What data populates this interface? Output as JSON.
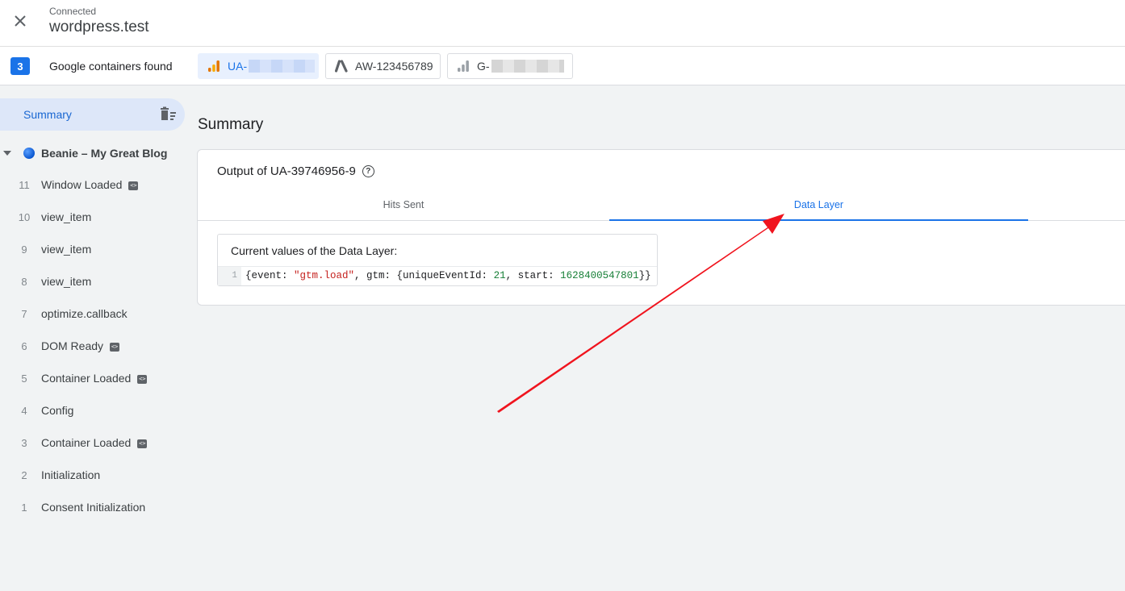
{
  "header": {
    "status": "Connected",
    "site": "wordpress.test"
  },
  "containers": {
    "count": "3",
    "label": "Google containers found",
    "chips": [
      {
        "id": "UA-",
        "redacted": true,
        "active": true
      },
      {
        "id": "AW-123456789",
        "redacted": false,
        "active": false
      },
      {
        "id": "G-",
        "redacted": true,
        "active": false
      }
    ]
  },
  "sidebar": {
    "summary_label": "Summary",
    "page_label": "Beanie – My Great Blog",
    "events": [
      {
        "num": "11",
        "label": "Window Loaded",
        "code": true
      },
      {
        "num": "10",
        "label": "view_item",
        "code": false
      },
      {
        "num": "9",
        "label": "view_item",
        "code": false
      },
      {
        "num": "8",
        "label": "view_item",
        "code": false
      },
      {
        "num": "7",
        "label": "optimize.callback",
        "code": false
      },
      {
        "num": "6",
        "label": "DOM Ready",
        "code": true
      },
      {
        "num": "5",
        "label": "Container Loaded",
        "code": true
      },
      {
        "num": "4",
        "label": "Config",
        "code": false
      },
      {
        "num": "3",
        "label": "Container Loaded",
        "code": true
      },
      {
        "num": "2",
        "label": "Initialization",
        "code": false
      },
      {
        "num": "1",
        "label": "Consent Initialization",
        "code": false
      }
    ]
  },
  "main": {
    "title": "Summary",
    "card_title": "Output of UA-39746956-9",
    "tabs": {
      "hits": "Hits Sent",
      "data_layer": "Data Layer"
    },
    "data_layer": {
      "header": "Current values of the Data Layer:",
      "line_number": "1",
      "code": {
        "p1": "{event: ",
        "event_value": "\"gtm.load\"",
        "p2": ", gtm: {uniqueEventId: ",
        "unique_event_id": "21",
        "p3": ", start: ",
        "start": "1628400547801",
        "p4": "}}"
      }
    }
  },
  "annotation": {
    "arrow_color": "#f0141e"
  },
  "colors": {
    "accent": "#1a73e8",
    "selected_bg": "#dde7f9"
  }
}
